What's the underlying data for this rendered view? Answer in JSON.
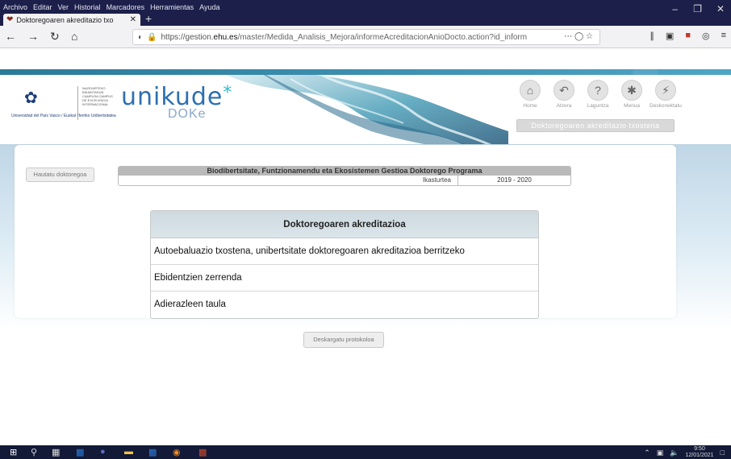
{
  "browser": {
    "menus": [
      "Archivo",
      "Editar",
      "Ver",
      "Historial",
      "Marcadores",
      "Herramientas",
      "Ayuda"
    ],
    "tab_title": "Doktoregoaren akreditazio txo",
    "url_prefix": "https://gestion.",
    "url_host": "ehu.es",
    "url_path": "/master/Medida_Analisis_Mejora/informeAcreditacionAnioDocto.action?id_inform"
  },
  "header": {
    "logo_university": "Universidad del País Vasco / Euskal Herriko Unibertsitatea",
    "logo_campus": "NAZIOARTEKO BIKAINTASUN CAMPUSA CAMPUS DE EXCELENCIA INTERNACIONAL",
    "app_name": "unikude",
    "app_sub": "DOKe",
    "nav": [
      {
        "label": "Home",
        "icon": "home-icon"
      },
      {
        "label": "Atzera",
        "icon": "back-arrow-icon"
      },
      {
        "label": "Laguntza",
        "icon": "help-icon"
      },
      {
        "label": "Menua",
        "icon": "menu-icon"
      },
      {
        "label": "Deskonektatu",
        "icon": "disconnect-icon"
      }
    ],
    "section_title": "Doktoregoaren akreditazio txostena"
  },
  "page": {
    "back_button": "Hautatu doktoregoa",
    "program_name": "Biodibertsitate, Funtzionamendu eta Ekosistemen Gestioa Doktorego Programa",
    "year_label": "Ikasturtea",
    "year_value": "2019 - 2020",
    "akreditazioa": {
      "title": "Doktoregoaren akreditazioa",
      "items": [
        "Autoebaluazio txostena, unibertsitate doktoregoaren akreditazioa berritzeko",
        "Ebidentzien zerrenda",
        "Adierazleen taula"
      ]
    },
    "download_button": "Deskargatu protokoloa"
  },
  "taskbar": {
    "time": "9:50",
    "date": "12/01/2021"
  }
}
